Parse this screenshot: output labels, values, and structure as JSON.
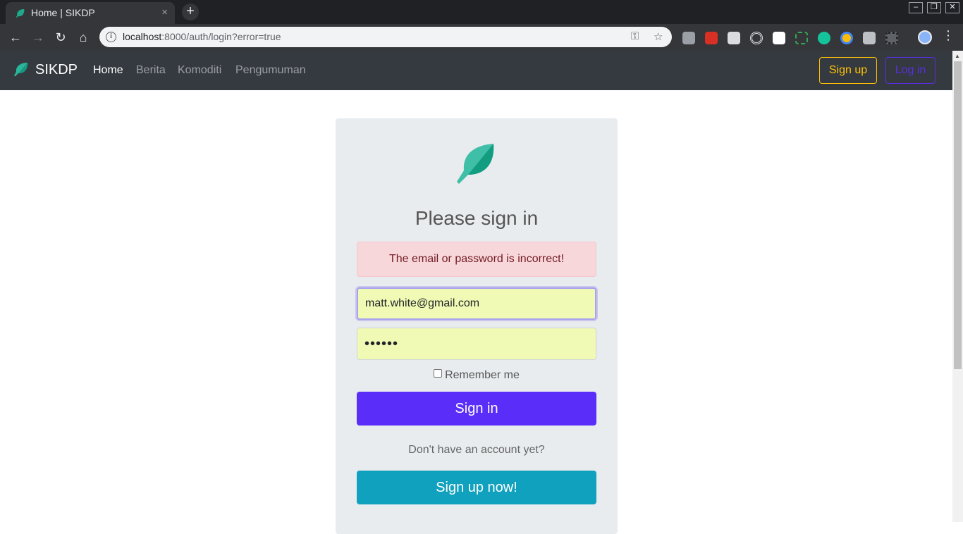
{
  "browser": {
    "tab_title": "Home | SIKDP",
    "tab_close": "×",
    "new_tab": "+",
    "url_host": "localhost",
    "url_rest": ":8000/auth/login?error=true",
    "window_controls": [
      "–",
      "❐",
      "✕"
    ],
    "nav_icons": [
      "back-icon",
      "forward-icon",
      "reload-icon",
      "home-icon"
    ],
    "extensions": [
      "puzzle-icon",
      "santa-icon",
      "cube-icon",
      "target-icon",
      "tag-icon",
      "screenshot-icon",
      "grammarly-icon",
      "chrome-icon",
      "bulb-icon",
      "qr-icon"
    ]
  },
  "navbar": {
    "brand": "SIKDP",
    "links": [
      "Home",
      "Berita",
      "Komoditi",
      "Pengumuman"
    ],
    "signup_label": "Sign up",
    "login_label": "Log in"
  },
  "login": {
    "heading": "Please sign in",
    "error": "The email or password is incorrect!",
    "email_value": "matt.white@gmail.com",
    "password_mask": "••••••",
    "remember_label": "Remember me",
    "signin_label": "Sign in",
    "no_account": "Don't have an account yet?",
    "signup_now_label": "Sign up now!"
  },
  "colors": {
    "navbar_bg": "#343a40",
    "primary": "#5a2df8",
    "info": "#0fa1bd",
    "warning": "#ffc107",
    "leaf": "#1fa88a"
  }
}
